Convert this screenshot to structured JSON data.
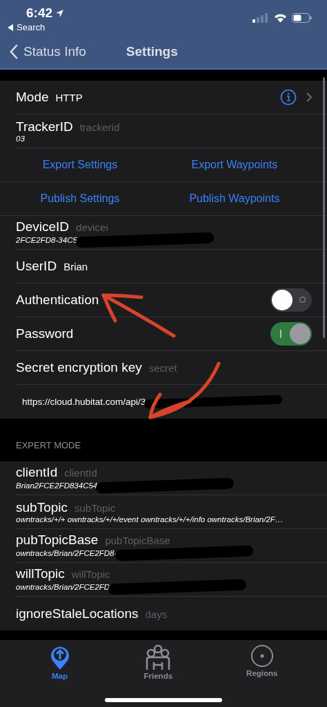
{
  "status_bar": {
    "time": "6:42",
    "back_app": "Search"
  },
  "nav": {
    "back": "Status Info",
    "title": "Settings"
  },
  "settings": [
    {
      "kind": "select",
      "label": "Mode",
      "value": "HTTP"
    },
    {
      "kind": "field",
      "label": "TrackerID",
      "placeholder": "trackerid",
      "value": "03"
    },
    {
      "kind": "buttons",
      "buttons": [
        "Export Settings",
        "Export Waypoints"
      ]
    },
    {
      "kind": "buttons",
      "buttons": [
        "Publish Settings",
        "Publish Waypoints"
      ]
    },
    {
      "kind": "field",
      "label": "DeviceID",
      "placeholder": "devicei",
      "value": "2FCE2FD8-34C5",
      "redacted": true
    },
    {
      "kind": "inline",
      "label": "UserID",
      "value": "Brian"
    },
    {
      "kind": "toggle",
      "label": "Authentication",
      "on": false
    },
    {
      "kind": "toggle",
      "label": "Password",
      "on": true
    },
    {
      "kind": "field",
      "label": "Secret encryption key",
      "placeholder": "secret"
    },
    {
      "kind": "url",
      "value": "https://cloud.hubitat.com/api/3",
      "redacted": true
    }
  ],
  "expert_header": "EXPERT MODE",
  "expert": [
    {
      "kind": "field",
      "label": "clientId",
      "placeholder": "clientId",
      "value": "Brian2FCE2FD834C54",
      "redacted": true
    },
    {
      "kind": "field",
      "label": "subTopic",
      "placeholder": "subTopic",
      "value": "owntracks/+/+ owntracks/+/+/event owntracks/+/+/info owntracks/Brian/2F…"
    },
    {
      "kind": "field",
      "label": "pubTopicBase",
      "placeholder": "pubTopicBase",
      "value": "owntracks/Brian/2FCE2FD8-",
      "redacted": true
    },
    {
      "kind": "field",
      "label": "willTopic",
      "placeholder": "willTopic",
      "value": "owntracks/Brian/2FCE2FD",
      "redacted": true
    },
    {
      "kind": "field",
      "label": "ignoreStaleLocations",
      "placeholder": "days"
    }
  ],
  "tab_bar": [
    {
      "label": "Map",
      "selected": true,
      "kind": "map"
    },
    {
      "label": "Friends",
      "selected": false,
      "kind": "friends"
    },
    {
      "label": "Regions",
      "selected": false,
      "kind": "regions"
    }
  ]
}
